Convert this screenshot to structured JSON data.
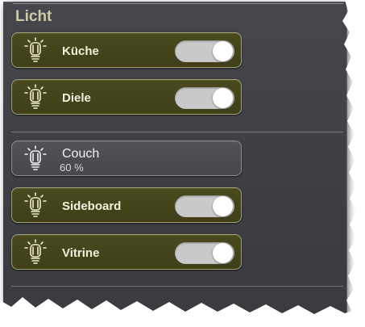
{
  "section": {
    "title": "Licht"
  },
  "lights": [
    {
      "label": "Küche",
      "state": "on"
    },
    {
      "label": "Diele",
      "state": "on"
    },
    {
      "label": "Couch",
      "value": "60 %",
      "state": "dimmer"
    },
    {
      "label": "Sideboard",
      "state": "on"
    },
    {
      "label": "Vitrine",
      "state": "on"
    }
  ],
  "colors": {
    "panel": "#3f4146",
    "tile_on": "#42421a",
    "tile_off": "#4b4d52",
    "title": "#cfc9a8",
    "toggle_track": "#c9c9c9"
  },
  "icons": {
    "light": "light-bulb-icon",
    "switch": "toggle-switch"
  }
}
